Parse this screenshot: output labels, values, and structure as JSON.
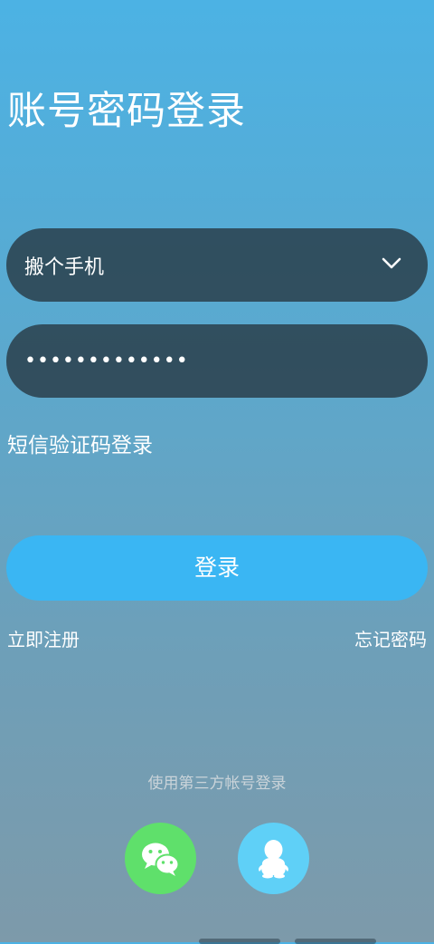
{
  "header": {
    "title": "账号密码登录"
  },
  "form": {
    "account_value": "搬个手机",
    "password_value": "•••••••••••••",
    "account_dropdown_icon": "chevron-down-icon"
  },
  "links": {
    "sms_login": "短信验证码登录",
    "register": "立即注册",
    "forgot_password": "忘记密码"
  },
  "buttons": {
    "login": "登录"
  },
  "third_party": {
    "label": "使用第三方帐号登录",
    "providers": [
      {
        "name": "wechat",
        "icon": "wechat-icon",
        "color": "#5fe06b"
      },
      {
        "name": "qq",
        "icon": "qq-penguin-icon",
        "color": "#5fd0f7"
      }
    ]
  },
  "colors": {
    "accent": "#3ab6f3",
    "field_bg": "#283a46"
  }
}
